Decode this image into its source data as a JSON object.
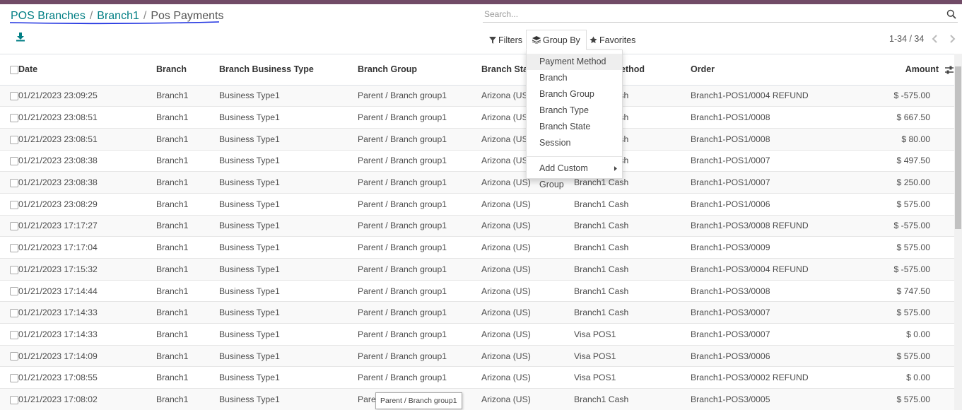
{
  "breadcrumb": {
    "level1": "POS Branches",
    "level2": "Branch1",
    "current": "Pos Payments",
    "separator": "/"
  },
  "search": {
    "placeholder": "Search..."
  },
  "controls": {
    "filters": "Filters",
    "group_by": "Group By",
    "favorites": "Favorites"
  },
  "pager": {
    "range": "1-34 / 34"
  },
  "columns": {
    "date": "Date",
    "branch": "Branch",
    "business_type": "Branch Business Type",
    "group": "Branch Group",
    "state": "Branch State",
    "method": "Payment Method",
    "order": "Order",
    "amount": "Amount"
  },
  "rows": [
    {
      "date": "01/21/2023 23:09:25",
      "branch": "Branch1",
      "business_type": "Business Type1",
      "group": "Parent / Branch group1",
      "state": "Arizona (US)",
      "method": "Branch1 Cash",
      "order": "Branch1-POS1/0004 REFUND",
      "amount": "$ -575.00"
    },
    {
      "date": "01/21/2023 23:08:51",
      "branch": "Branch1",
      "business_type": "Business Type1",
      "group": "Parent / Branch group1",
      "state": "Arizona (US)",
      "method": "Branch1 Cash",
      "order": "Branch1-POS1/0008",
      "amount": "$ 667.50"
    },
    {
      "date": "01/21/2023 23:08:51",
      "branch": "Branch1",
      "business_type": "Business Type1",
      "group": "Parent / Branch group1",
      "state": "Arizona (US)",
      "method": "Branch1 Cash",
      "order": "Branch1-POS1/0008",
      "amount": "$ 80.00"
    },
    {
      "date": "01/21/2023 23:08:38",
      "branch": "Branch1",
      "business_type": "Business Type1",
      "group": "Parent / Branch group1",
      "state": "Arizona (US)",
      "method": "Branch1 Cash",
      "order": "Branch1-POS1/0007",
      "amount": "$ 497.50"
    },
    {
      "date": "01/21/2023 23:08:38",
      "branch": "Branch1",
      "business_type": "Business Type1",
      "group": "Parent / Branch group1",
      "state": "Arizona (US)",
      "method": "Branch1 Cash",
      "order": "Branch1-POS1/0007",
      "amount": "$ 250.00"
    },
    {
      "date": "01/21/2023 23:08:29",
      "branch": "Branch1",
      "business_type": "Business Type1",
      "group": "Parent / Branch group1",
      "state": "Arizona (US)",
      "method": "Branch1 Cash",
      "order": "Branch1-POS1/0006",
      "amount": "$ 575.00"
    },
    {
      "date": "01/21/2023 17:17:27",
      "branch": "Branch1",
      "business_type": "Business Type1",
      "group": "Parent / Branch group1",
      "state": "Arizona (US)",
      "method": "Branch1 Cash",
      "order": "Branch1-POS3/0008 REFUND",
      "amount": "$ -575.00"
    },
    {
      "date": "01/21/2023 17:17:04",
      "branch": "Branch1",
      "business_type": "Business Type1",
      "group": "Parent / Branch group1",
      "state": "Arizona (US)",
      "method": "Branch1 Cash",
      "order": "Branch1-POS3/0009",
      "amount": "$ 575.00"
    },
    {
      "date": "01/21/2023 17:15:32",
      "branch": "Branch1",
      "business_type": "Business Type1",
      "group": "Parent / Branch group1",
      "state": "Arizona (US)",
      "method": "Branch1 Cash",
      "order": "Branch1-POS3/0004 REFUND",
      "amount": "$ -575.00"
    },
    {
      "date": "01/21/2023 17:14:44",
      "branch": "Branch1",
      "business_type": "Business Type1",
      "group": "Parent / Branch group1",
      "state": "Arizona (US)",
      "method": "Branch1 Cash",
      "order": "Branch1-POS3/0008",
      "amount": "$ 747.50"
    },
    {
      "date": "01/21/2023 17:14:33",
      "branch": "Branch1",
      "business_type": "Business Type1",
      "group": "Parent / Branch group1",
      "state": "Arizona (US)",
      "method": "Branch1 Cash",
      "order": "Branch1-POS3/0007",
      "amount": "$ 575.00"
    },
    {
      "date": "01/21/2023 17:14:33",
      "branch": "Branch1",
      "business_type": "Business Type1",
      "group": "Parent / Branch group1",
      "state": "Arizona (US)",
      "method": "Visa POS1",
      "order": "Branch1-POS3/0007",
      "amount": "$ 0.00"
    },
    {
      "date": "01/21/2023 17:14:09",
      "branch": "Branch1",
      "business_type": "Business Type1",
      "group": "Parent / Branch group1",
      "state": "Arizona (US)",
      "method": "Visa POS1",
      "order": "Branch1-POS3/0006",
      "amount": "$ 575.00"
    },
    {
      "date": "01/21/2023 17:08:55",
      "branch": "Branch1",
      "business_type": "Business Type1",
      "group": "Parent / Branch group1",
      "state": "Arizona (US)",
      "method": "Visa POS1",
      "order": "Branch1-POS3/0002 REFUND",
      "amount": "$ 0.00"
    },
    {
      "date": "01/21/2023 17:08:02",
      "branch": "Branch1",
      "business_type": "Business Type1",
      "group": "Parent / Branch group1",
      "state": "Arizona (US)",
      "method": "Branch1 Cash",
      "order": "Branch1-POS3/0005",
      "amount": "$ 575.00"
    }
  ],
  "group_by_menu": {
    "items": [
      "Payment Method",
      "Branch",
      "Branch Group",
      "Branch Type",
      "Branch State",
      "Session"
    ],
    "custom": "Add Custom Group"
  },
  "tooltip": {
    "text": "Parent / Branch group1"
  },
  "colors": {
    "accent": "#017e84",
    "brand_bar": "#714B67",
    "underline": "#1b2ee0"
  }
}
